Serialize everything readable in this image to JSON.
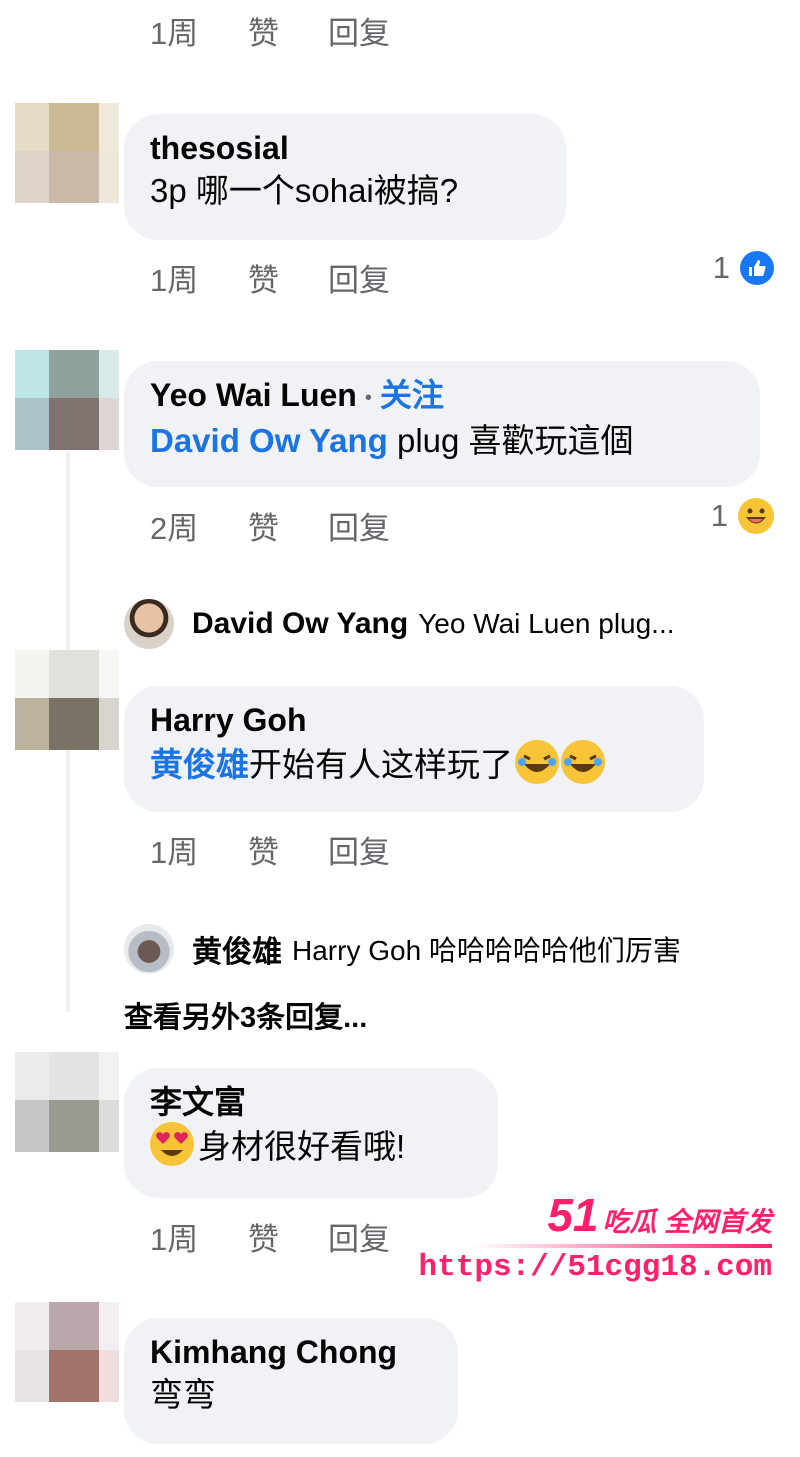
{
  "actions": {
    "time_1w": "1周",
    "time_2w": "2周",
    "like": "赞",
    "reply": "回复"
  },
  "comments": [
    {
      "name": "thesosial",
      "text": "3p 哪一个sohai被搞?",
      "time": "1周",
      "reaction_count": "1",
      "reaction_icon": "like-icon"
    },
    {
      "name": "Yeo Wai Luen",
      "follow": "关注",
      "mention": "David Ow Yang",
      "text": " plug 喜歡玩這個",
      "time": "2周",
      "reaction_count": "1",
      "reaction_icon": "laugh-icon"
    },
    {
      "name": "Harry Goh",
      "mention": "黄俊雄",
      "text": "开始有人这样玩了",
      "time": "1周"
    },
    {
      "name": "李文富",
      "text": "身材很好看哦!",
      "time": "1周"
    },
    {
      "name": "Kimhang Chong",
      "text": "弯弯"
    }
  ],
  "replies": [
    {
      "name": "David Ow Yang",
      "text": "Yeo Wai Luen plug..."
    },
    {
      "name": "黄俊雄",
      "text": "Harry Goh 哈哈哈哈哈他们厉害"
    }
  ],
  "view_more": "查看另外3条回复...",
  "watermark": {
    "brand_num": "51",
    "brand_text": "吃瓜 全网首发",
    "url": "https://51cgg18.com"
  },
  "colors": {
    "link": "#1b74e4",
    "bubble": "#f0f2f5",
    "muted": "#65676b",
    "watermark": "#ff1f6b"
  }
}
